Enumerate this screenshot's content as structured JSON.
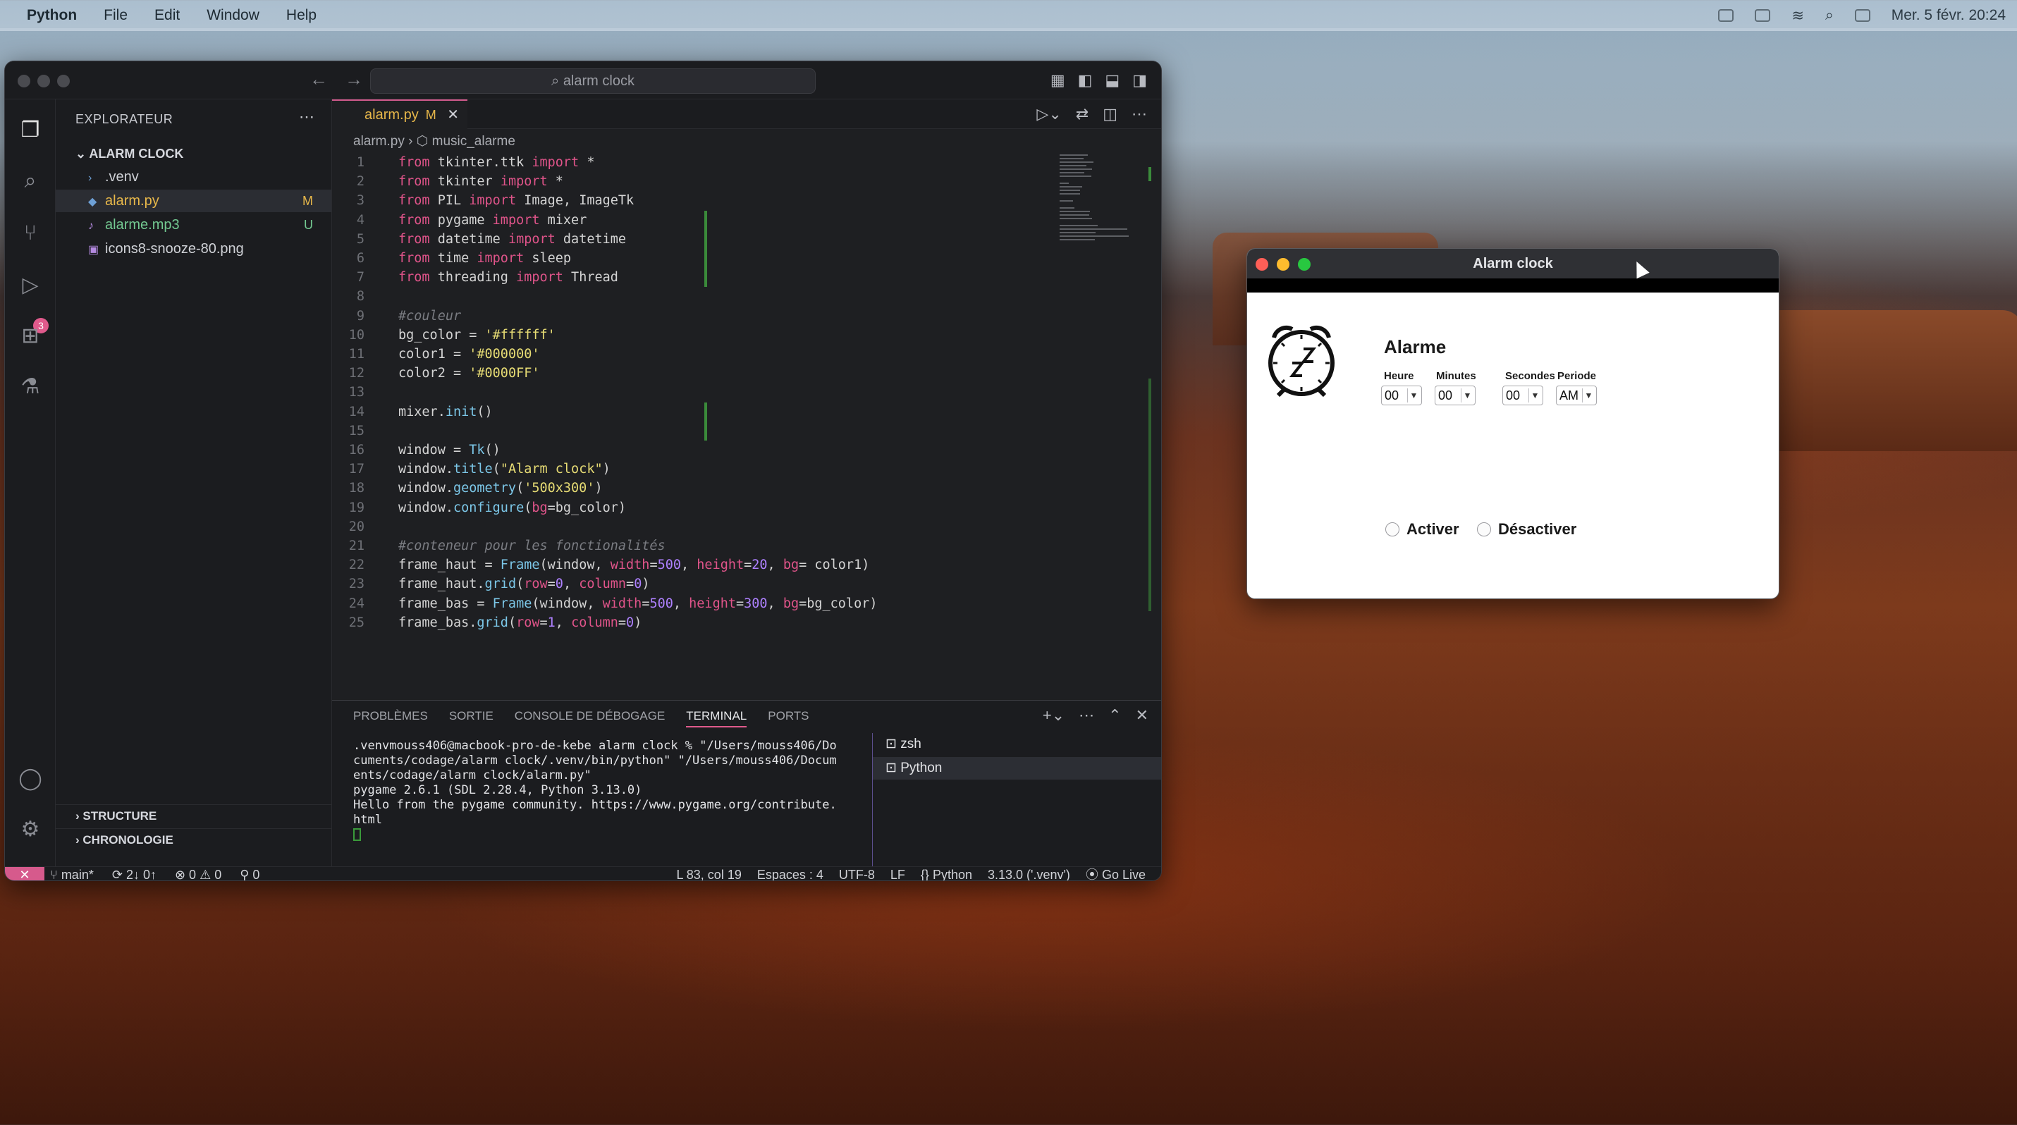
{
  "menubar": {
    "app": "Python",
    "items": [
      "File",
      "Edit",
      "Window",
      "Help"
    ],
    "clock": "Mer. 5 févr. 20:24"
  },
  "vscode": {
    "search": "alarm clock",
    "explorer_title": "EXPLORATEUR",
    "folder": "ALARM CLOCK",
    "files": [
      {
        "name": ".venv",
        "status": ""
      },
      {
        "name": "alarm.py",
        "status": "M"
      },
      {
        "name": "alarme.mp3",
        "status": "U"
      },
      {
        "name": "icons8-snooze-80.png",
        "status": ""
      }
    ],
    "sections": [
      "STRUCTURE",
      "CHRONOLOGIE"
    ],
    "badge": "3",
    "tab": {
      "label": "alarm.py",
      "mod": "M"
    },
    "breadcrumb": {
      "file": "alarm.py",
      "symbol": "music_alarme"
    },
    "code": [
      "from tkinter.ttk import *",
      "from tkinter import *",
      "from PIL import Image, ImageTk",
      "from pygame import mixer",
      "from datetime import datetime",
      "from time import sleep",
      "from threading import Thread",
      "",
      "#couleur",
      "bg_color = '#ffffff'",
      "color1 = '#000000'",
      "color2 = '#0000FF'",
      "",
      "mixer.init()",
      "",
      "window = Tk()",
      "window.title(\"Alarm clock\")",
      "window.geometry('500x300')",
      "window.configure(bg=bg_color)",
      "",
      "#conteneur pour les fonctionalités",
      "frame_haut = Frame(window, width=500, height=20, bg= color1)",
      "frame_haut.grid(row=0, column=0)",
      "frame_bas = Frame(window, width=500, height=300, bg=bg_color)",
      "frame_bas.grid(row=1, column=0)"
    ],
    "panel_tabs": [
      "PROBLÈMES",
      "SORTIE",
      "CONSOLE DE DÉBOGAGE",
      "TERMINAL",
      "PORTS"
    ],
    "terminal": [
      ".venvmouss406@macbook-pro-de-kebe alarm clock % \"/Users/mouss406/Do",
      "cuments/codage/alarm clock/.venv/bin/python\" \"/Users/mouss406/Docum",
      "ents/codage/alarm clock/alarm.py\"",
      "pygame 2.6.1 (SDL 2.28.4, Python 3.13.0)",
      "Hello from the pygame community. https://www.pygame.org/contribute.",
      "html"
    ],
    "terminals": [
      "zsh",
      "Python"
    ],
    "status": {
      "branch": "main*",
      "sync": "2↓ 0↑",
      "problems": "⊗ 0 ⚠ 0",
      "ports": "0",
      "position": "L 83, col 19",
      "spaces": "Espaces : 4",
      "encoding": "UTF-8",
      "eol": "LF",
      "language": "Python",
      "interpreter": "3.13.0 ('.venv')",
      "live": "Go Live"
    }
  },
  "alarm": {
    "title": "Alarm clock",
    "heading": "Alarme",
    "labels": [
      "Heure",
      "Minutes",
      "Secondes",
      "Periode"
    ],
    "values": [
      "00",
      "00",
      "00",
      "AM"
    ],
    "radio_on": "Activer",
    "radio_off": "Désactiver"
  }
}
